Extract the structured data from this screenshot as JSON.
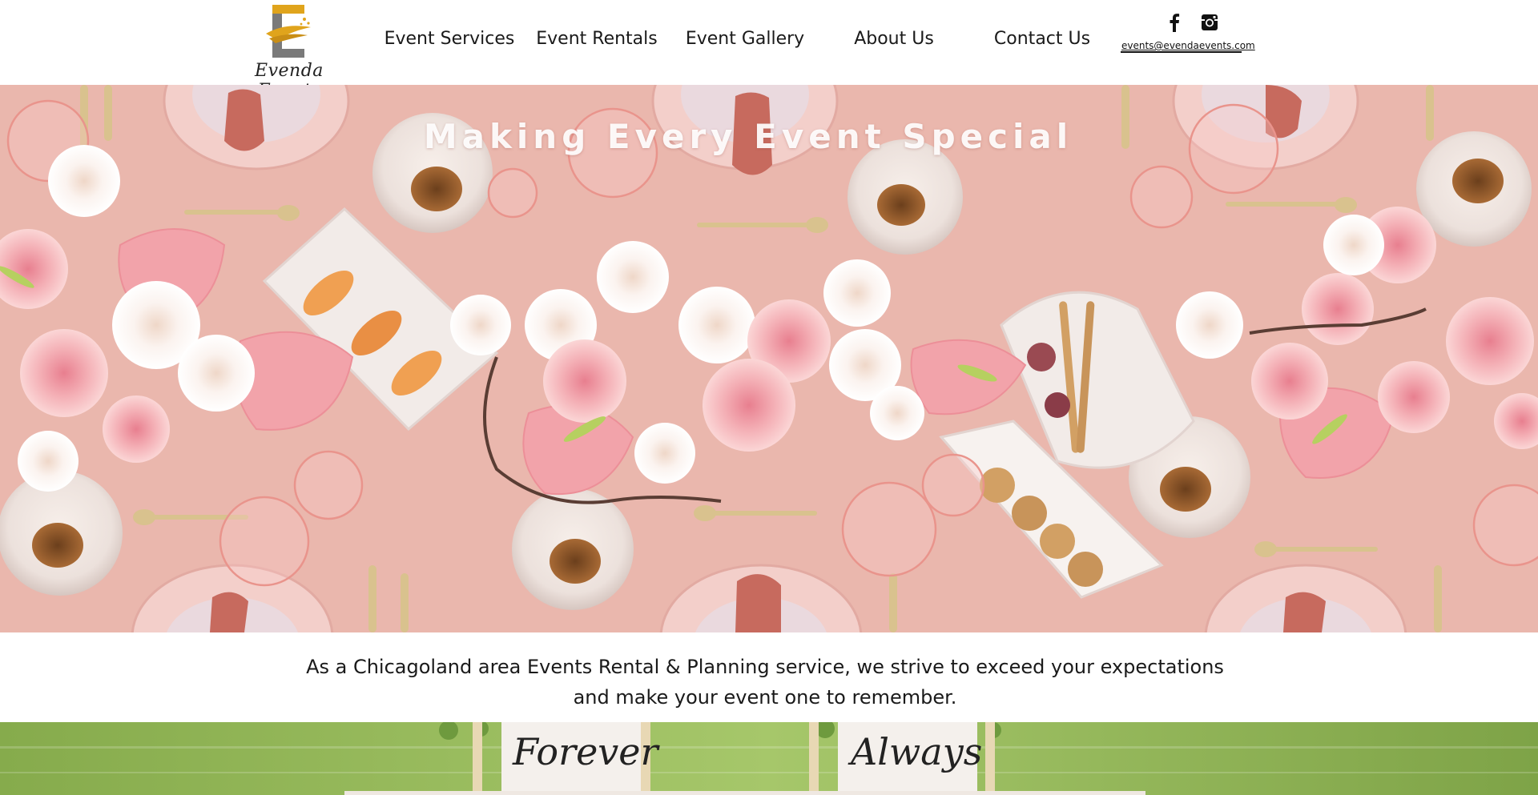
{
  "header": {
    "logo": {
      "text": "Evenda Events",
      "letter": "E"
    },
    "nav": [
      {
        "label": "Event Services"
      },
      {
        "label": "Event Rentals"
      },
      {
        "label": "Event Gallery"
      },
      {
        "label": "About Us"
      },
      {
        "label": "Contact Us"
      }
    ],
    "social": [
      {
        "name": "facebook-icon",
        "glyph": "f"
      },
      {
        "name": "instagram-icon"
      }
    ],
    "email": "events@evendaevents.com"
  },
  "hero": {
    "title": "Making Every Event Special"
  },
  "intro": {
    "line1": "As a Chicagoland area Events Rental & Planning service, we strive to exceed your expectations",
    "line2": "and make your event one to remember."
  },
  "banner": {
    "sign_left": "Forever",
    "sign_right": "Always"
  },
  "colors": {
    "hero_bg": "#eab7ad",
    "logo_gold": "#e0a41c",
    "logo_grey": "#7a7a7a",
    "grass": "#7fa548"
  }
}
